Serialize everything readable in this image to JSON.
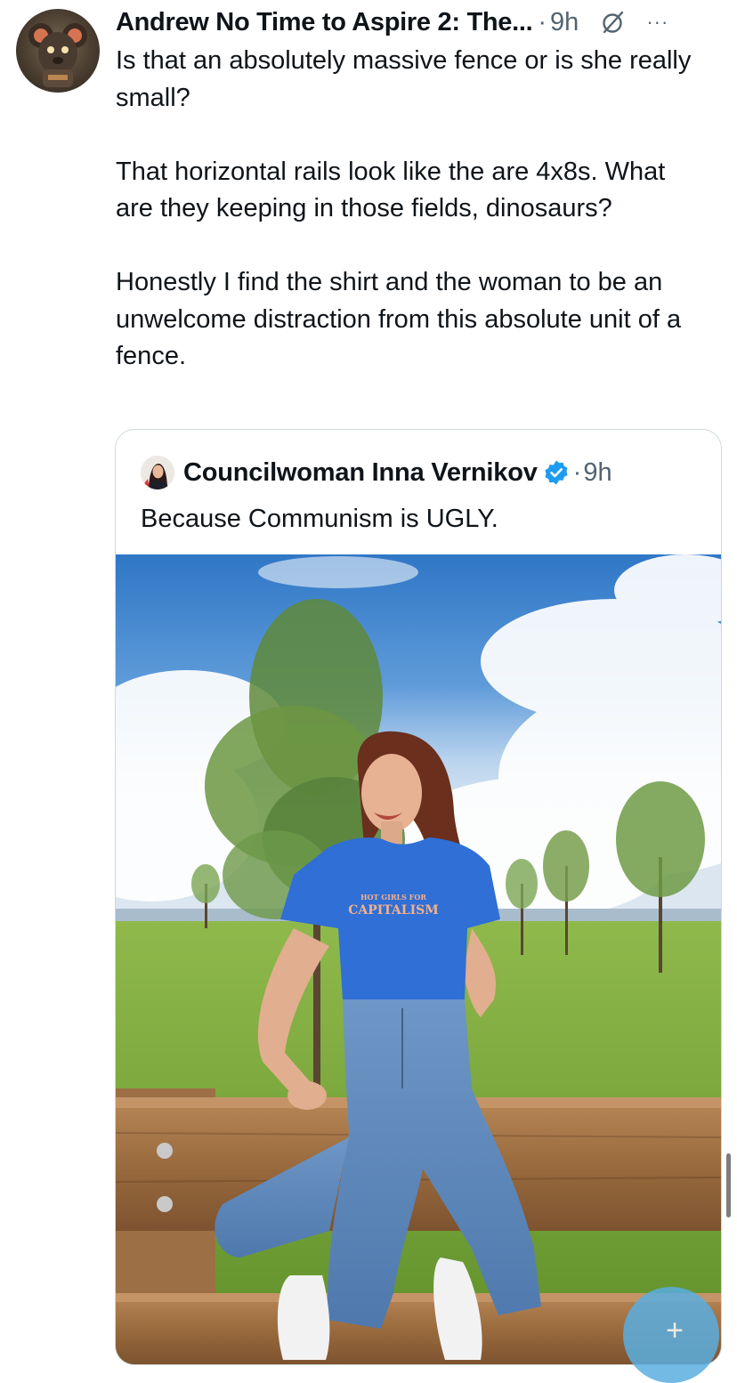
{
  "tweet": {
    "author_name": "Andrew No Time to Aspire 2: The...",
    "separator": "·",
    "time": "9h",
    "text": "Is that an absolutely massive fence or is she really small?\n\nThat horizontal rails look like the are 4x8s. What are they keeping in those fields, dinosaurs?\n\nHonestly I find the shirt and the woman to be an unwelcome distraction from this absolute unit of a fence.",
    "more_label": "···",
    "icons": [
      "grok-icon",
      "more-icon"
    ]
  },
  "quoted_tweet": {
    "author_name": "Councilwoman Inna Vernikov",
    "separator": "·",
    "time": "9h",
    "text": "Because Communism is UGLY.",
    "verified": true,
    "shirt_text_line1": "HOT GIRLS FOR",
    "shirt_text_line2": "CAPITALISM"
  },
  "fab": {
    "label": "+"
  },
  "colors": {
    "text": "#0f1419",
    "secondary": "#536471",
    "border": "#cfd9de",
    "verified": "#1d9bf0",
    "sky": "#3f86cf",
    "shirt": "#2f6fd6",
    "jeans": "#5b86b8",
    "grass": "#7ea83f",
    "wood": "#a27449"
  }
}
